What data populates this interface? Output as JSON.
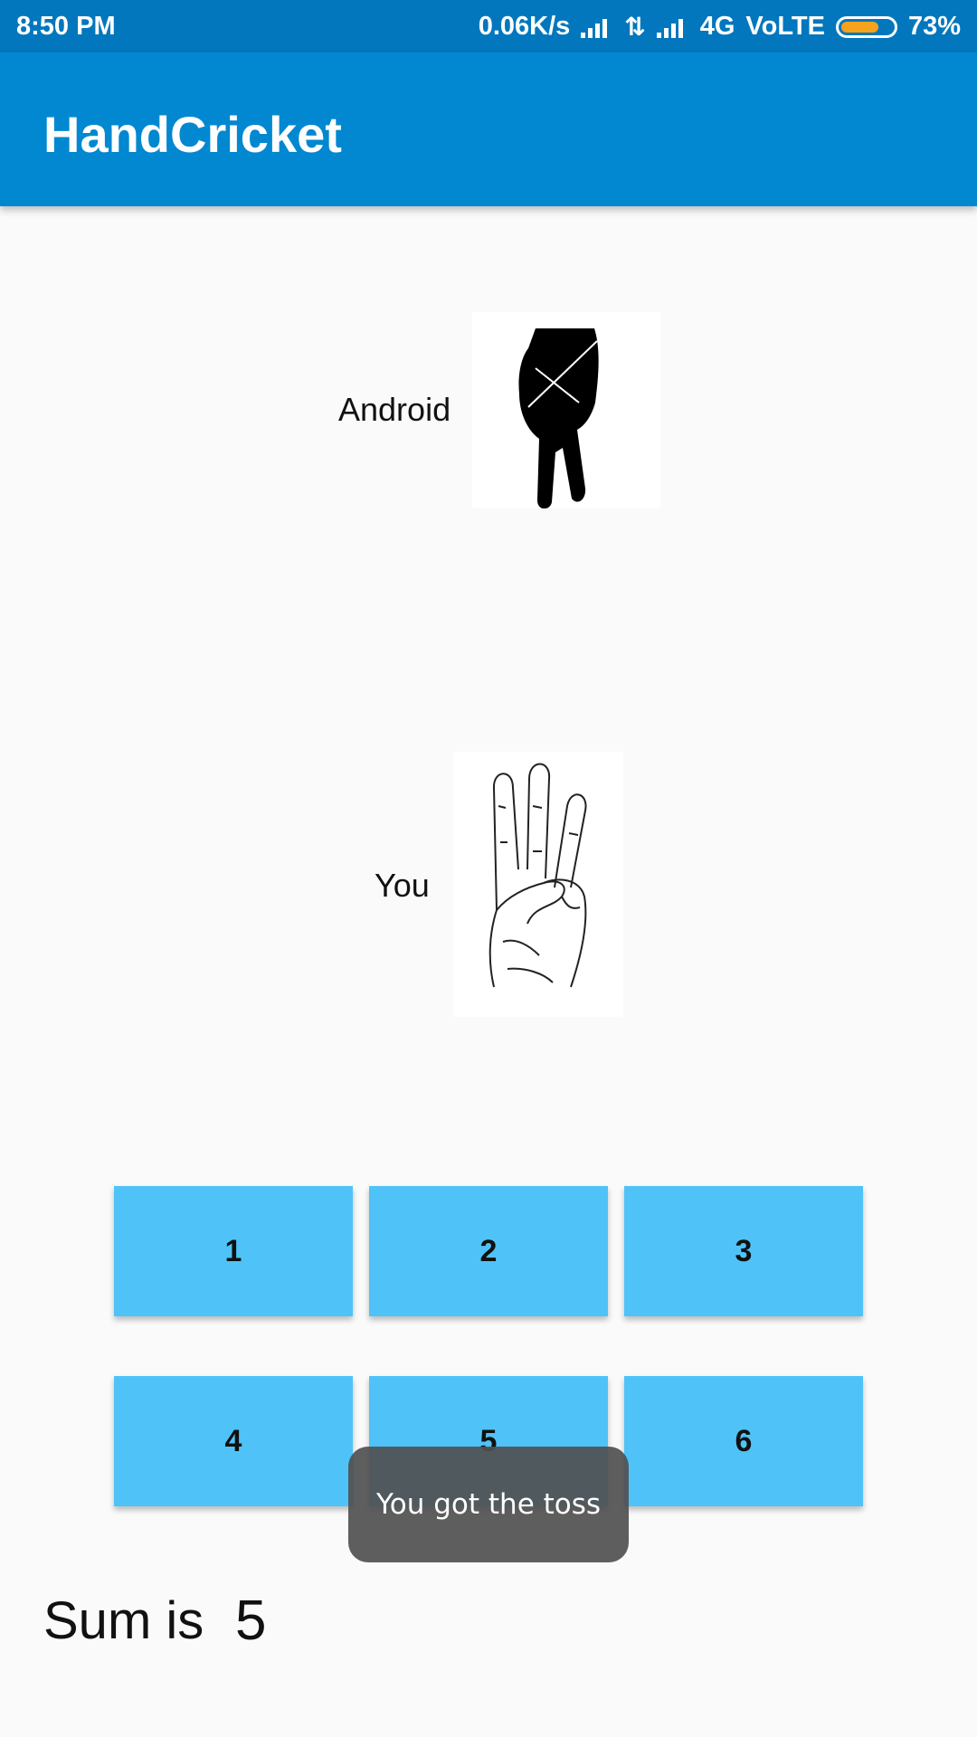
{
  "status": {
    "time": "8:50 PM",
    "net_speed": "0.06K/s",
    "network": "4G",
    "volte": "VoLTE",
    "battery": "73%",
    "battery_level": 0.73,
    "battery_color": "#f7a21b"
  },
  "app": {
    "title": "HandCricket"
  },
  "android": {
    "label": "Android",
    "icon": "two-finger-hand-silhouette-icon"
  },
  "player": {
    "label": "You",
    "icon": "three-finger-hand-sketch-icon"
  },
  "buttons": [
    "1",
    "2",
    "3",
    "4",
    "5",
    "6"
  ],
  "sum": {
    "label": "Sum is",
    "value": "5"
  },
  "toast": "You got the toss",
  "colors": {
    "appbar": "#0288d1",
    "statusbar": "#0277bd",
    "button": "#4fc3f7"
  }
}
